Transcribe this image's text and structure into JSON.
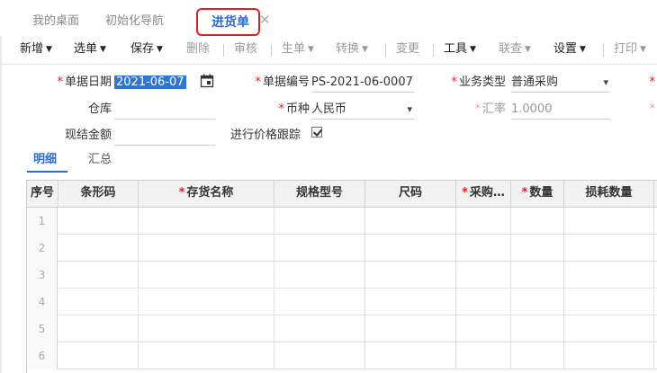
{
  "tabs": {
    "items": [
      "我的桌面",
      "初始化导航"
    ],
    "active": "进货单",
    "close_glyph": "✕"
  },
  "toolbar": {
    "new": "新增",
    "select_doc": "选单",
    "save": "保存",
    "delete": "删除",
    "audit": "审核",
    "generate": "生单",
    "convert": "转换",
    "change": "变更",
    "tools": "工具",
    "linked_query": "联查",
    "settings": "设置",
    "print": "打印"
  },
  "form": {
    "doc_date_label": "单据日期",
    "doc_date_value": "2021-06-07",
    "doc_no_label": "单据编号",
    "doc_no_value": "PS-2021-06-0007",
    "biz_type_label": "业务类型",
    "biz_type_value": "普通采购",
    "warehouse_label": "仓库",
    "warehouse_value": "",
    "currency_label": "币种",
    "currency_value": "人民币",
    "rate_label": "汇率",
    "rate_value": "1.0000",
    "cash_label": "现结金额",
    "cash_value": "",
    "price_track_label": "进行价格跟踪"
  },
  "subtabs": {
    "detail": "明细",
    "summary": "汇总"
  },
  "grid": {
    "columns": [
      "序号",
      "条形码",
      "存货名称",
      "规格型号",
      "尺码",
      "采购…",
      "数量",
      "损耗数量"
    ],
    "required_columns": [
      "存货名称",
      "采购…",
      "数量"
    ],
    "rows": [
      "1",
      "2",
      "3",
      "4",
      "5",
      "6"
    ]
  },
  "colors": {
    "accent": "#2a6bd6",
    "highlight_border": "#e02020",
    "required": "#e02020"
  }
}
